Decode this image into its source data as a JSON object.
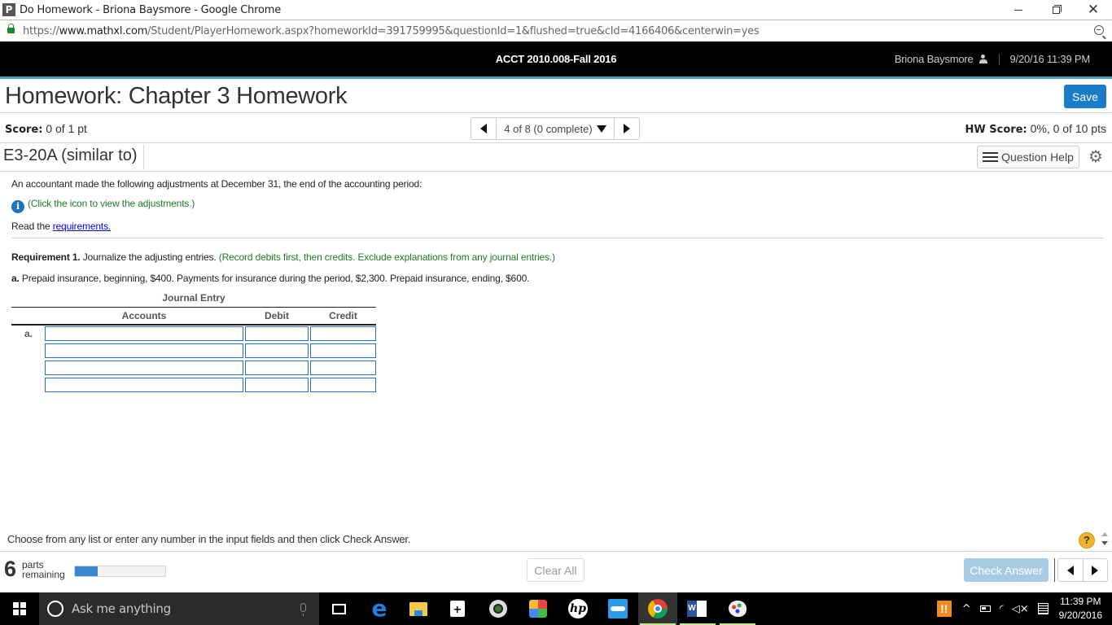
{
  "window": {
    "app_icon_letter": "P",
    "title": "Do Homework - Briona Baysmore - Google Chrome"
  },
  "address_bar": {
    "scheme": "https://",
    "host": "www.mathxl.com",
    "path": "/Student/PlayerHomework.aspx?homeworkId=391759995&questionId=1&flushed=true&cId=4166406&centerwin=yes"
  },
  "course_bar": {
    "course_title": "ACCT 2010.008-Fall 2016",
    "user_name": "Briona Baysmore",
    "datetime": "9/20/16 11:39 PM"
  },
  "homework": {
    "title": "Homework: Chapter 3 Homework",
    "save_label": "Save",
    "score_label": "Score:",
    "score_value": "0 of 1 pt",
    "pager_text": "4 of 8 (0 complete)",
    "hw_score_label": "HW Score:",
    "hw_score_value": "0%, 0 of 10 pts",
    "question_id": "E3-20A (similar to)",
    "question_help_label": "Question Help"
  },
  "question": {
    "intro": "An accountant made the following adjustments at December 31, the end of the accounting period:",
    "info_link_text": "(Click the icon to view the adjustments.)",
    "read_prefix": "Read the ",
    "requirements_link": "requirements.",
    "req1_label": "Requirement 1.",
    "req1_text": " Journalize the adjusting entries. ",
    "req1_note": "(Record debits first, then credits. Exclude explanations from any journal entries.)",
    "part_a_label": "a.",
    "part_a_text": " Prepaid insurance, beginning, $400. Payments for insurance during the period, $2,300. Prepaid insurance, ending, $600."
  },
  "journal": {
    "title": "Journal Entry",
    "headers": [
      "Accounts",
      "Debit",
      "Credit"
    ],
    "entry_label": "a.",
    "rows": [
      {
        "account": "",
        "debit": "",
        "credit": ""
      },
      {
        "account": "",
        "debit": "",
        "credit": ""
      },
      {
        "account": "",
        "debit": "",
        "credit": ""
      },
      {
        "account": "",
        "debit": "",
        "credit": ""
      }
    ]
  },
  "footer": {
    "instruction": "Choose from any list or enter any number in the input fields and then click Check Answer.",
    "help_symbol": "?",
    "parts_remaining_count": "6",
    "parts_label_line1": "parts",
    "parts_label_line2": "remaining",
    "progress_fraction": 0.25,
    "clear_all_label": "Clear All",
    "check_answer_label": "Check Answer"
  },
  "taskbar": {
    "search_placeholder": "Ask me anything",
    "tray_time": "11:39 PM",
    "tray_date": "9/20/2016",
    "warning_symbol": "!!",
    "hp_label": "hp"
  },
  "colors": {
    "accent_line": "#3ea0c2",
    "save_button": "#1a7bc8",
    "input_border": "#2a6ec9",
    "green_note": "#1f7a25",
    "progress_fill": "#3b87cf",
    "check_answer_disabled": "#a8cbe5"
  }
}
